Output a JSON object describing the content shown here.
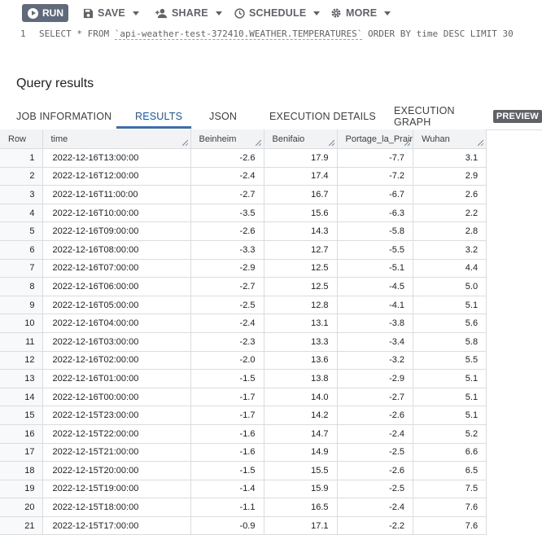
{
  "toolbar": {
    "run_label": "RUN",
    "save_label": "SAVE",
    "share_label": "SHARE",
    "schedule_label": "SCHEDULE",
    "more_label": "MORE"
  },
  "editor": {
    "line_number": "1",
    "query_prefix": "SELECT * FROM ",
    "table_ref": "`api-weather-test-372410.WEATHER.TEMPERATURES`",
    "query_suffix": " ORDER BY time DESC LIMIT 30"
  },
  "results": {
    "title": "Query results",
    "tabs": [
      "JOB INFORMATION",
      "RESULTS",
      "JSON",
      "EXECUTION DETAILS",
      "EXECUTION GRAPH"
    ],
    "preview_badge": "PREVIEW",
    "active_tab": "RESULTS"
  },
  "table": {
    "columns": [
      "Row",
      "time",
      "Beinheim",
      "Benifaio",
      "Portage_la_Prair",
      "Wuhan"
    ],
    "rows": [
      [
        "1",
        "2022-12-16T13:00:00",
        "-2.6",
        "17.9",
        "-7.7",
        "3.1"
      ],
      [
        "2",
        "2022-12-16T12:00:00",
        "-2.4",
        "17.4",
        "-7.2",
        "2.9"
      ],
      [
        "3",
        "2022-12-16T11:00:00",
        "-2.7",
        "16.7",
        "-6.7",
        "2.6"
      ],
      [
        "4",
        "2022-12-16T10:00:00",
        "-3.5",
        "15.6",
        "-6.3",
        "2.2"
      ],
      [
        "5",
        "2022-12-16T09:00:00",
        "-2.6",
        "14.3",
        "-5.8",
        "2.8"
      ],
      [
        "6",
        "2022-12-16T08:00:00",
        "-3.3",
        "12.7",
        "-5.5",
        "3.2"
      ],
      [
        "7",
        "2022-12-16T07:00:00",
        "-2.9",
        "12.5",
        "-5.1",
        "4.4"
      ],
      [
        "8",
        "2022-12-16T06:00:00",
        "-2.7",
        "12.5",
        "-4.5",
        "5.0"
      ],
      [
        "9",
        "2022-12-16T05:00:00",
        "-2.5",
        "12.8",
        "-4.1",
        "5.1"
      ],
      [
        "10",
        "2022-12-16T04:00:00",
        "-2.4",
        "13.1",
        "-3.8",
        "5.6"
      ],
      [
        "11",
        "2022-12-16T03:00:00",
        "-2.3",
        "13.3",
        "-3.4",
        "5.8"
      ],
      [
        "12",
        "2022-12-16T02:00:00",
        "-2.0",
        "13.6",
        "-3.2",
        "5.5"
      ],
      [
        "13",
        "2022-12-16T01:00:00",
        "-1.5",
        "13.8",
        "-2.9",
        "5.1"
      ],
      [
        "14",
        "2022-12-16T00:00:00",
        "-1.7",
        "14.0",
        "-2.7",
        "5.1"
      ],
      [
        "15",
        "2022-12-15T23:00:00",
        "-1.7",
        "14.2",
        "-2.6",
        "5.1"
      ],
      [
        "16",
        "2022-12-15T22:00:00",
        "-1.6",
        "14.7",
        "-2.4",
        "5.2"
      ],
      [
        "17",
        "2022-12-15T21:00:00",
        "-1.6",
        "14.9",
        "-2.5",
        "6.6"
      ],
      [
        "18",
        "2022-12-15T20:00:00",
        "-1.5",
        "15.5",
        "-2.6",
        "6.5"
      ],
      [
        "19",
        "2022-12-15T19:00:00",
        "-1.4",
        "15.9",
        "-2.5",
        "7.5"
      ],
      [
        "20",
        "2022-12-15T18:00:00",
        "-1.1",
        "16.5",
        "-2.4",
        "7.6"
      ],
      [
        "21",
        "2022-12-15T17:00:00",
        "-0.9",
        "17.1",
        "-2.2",
        "7.6"
      ]
    ]
  },
  "colors": {
    "run_button": "#5f6b7d",
    "active_tab": "#1a73e8",
    "header_bg": "#f1f3f4",
    "grid_line": "#dadce0"
  },
  "icons": [
    "play-icon",
    "save-icon",
    "share-icon",
    "schedule-icon",
    "more-gear-icon"
  ]
}
